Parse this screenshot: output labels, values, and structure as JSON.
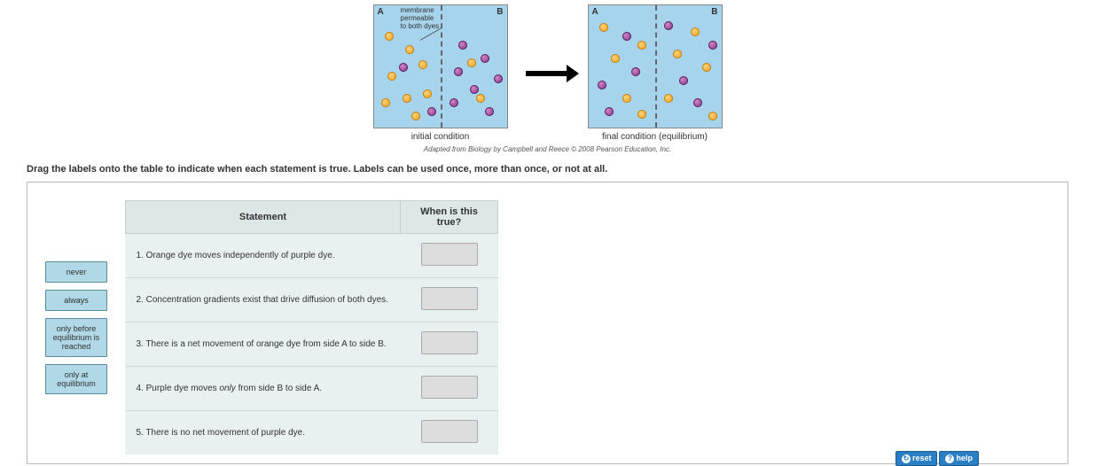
{
  "diagram": {
    "label_a": "A",
    "label_b": "B",
    "membrane_annot_l1": "membrane",
    "membrane_annot_l2": "permeable",
    "membrane_annot_l3": "to both dyes",
    "caption_initial": "initial condition",
    "caption_final": "final condition (equilibrium)",
    "citation": "Adapted from Biology by Campbell and Reece © 2008 Pearson Education, Inc."
  },
  "instruction": "Drag the labels onto the table to indicate when each statement is true. Labels can be used once, more than once, or not at all.",
  "labels": {
    "l1": "never",
    "l2": "always",
    "l3": "only before equilibrium is reached",
    "l4": "only at equilibrium"
  },
  "table": {
    "header_statement": "Statement",
    "header_when": "When is this true?",
    "rows": {
      "r1": "1. Orange dye moves independently of purple dye.",
      "r2": "2. Concentration gradients exist that drive diffusion of both dyes.",
      "r3": "3. There is a net movement of orange dye from side A to side B.",
      "r4_pre": "4. Purple dye moves ",
      "r4_em": "only",
      "r4_post": " from side B to side A.",
      "r5": "5. There is no net movement of purple dye."
    }
  },
  "buttons": {
    "reset": "reset",
    "help": "help"
  }
}
